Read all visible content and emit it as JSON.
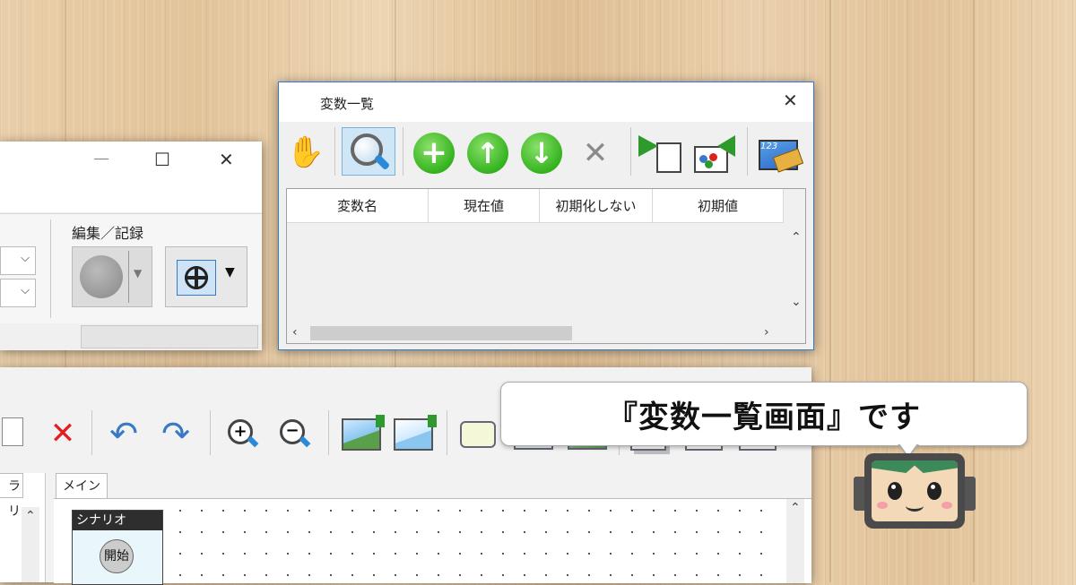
{
  "var_window": {
    "title": "変数一覧",
    "close_glyph": "✕",
    "columns": [
      "変数名",
      "現在値",
      "初期化しない",
      "初期値"
    ],
    "rows": []
  },
  "left_window": {
    "group_label": "編集／記録",
    "minimize_glyph": "—",
    "maximize_glyph": "☐",
    "close_glyph": "✕"
  },
  "bottom_window": {
    "tab_main": "メイン",
    "tab_partial": "ラリ",
    "node_title": "シナリオ",
    "node_start": "開始"
  },
  "bubble": {
    "text": "『変数一覧画面』です"
  },
  "icons": {
    "hand": "hand-icon",
    "search": "magnifier-icon",
    "add": "plus-icon",
    "up": "arrow-up-icon",
    "down": "arrow-down-icon",
    "delete": "x-icon"
  },
  "colors": {
    "green": "#35b31f",
    "accent_blue": "#3a78c8",
    "delete_red": "#e02020"
  }
}
